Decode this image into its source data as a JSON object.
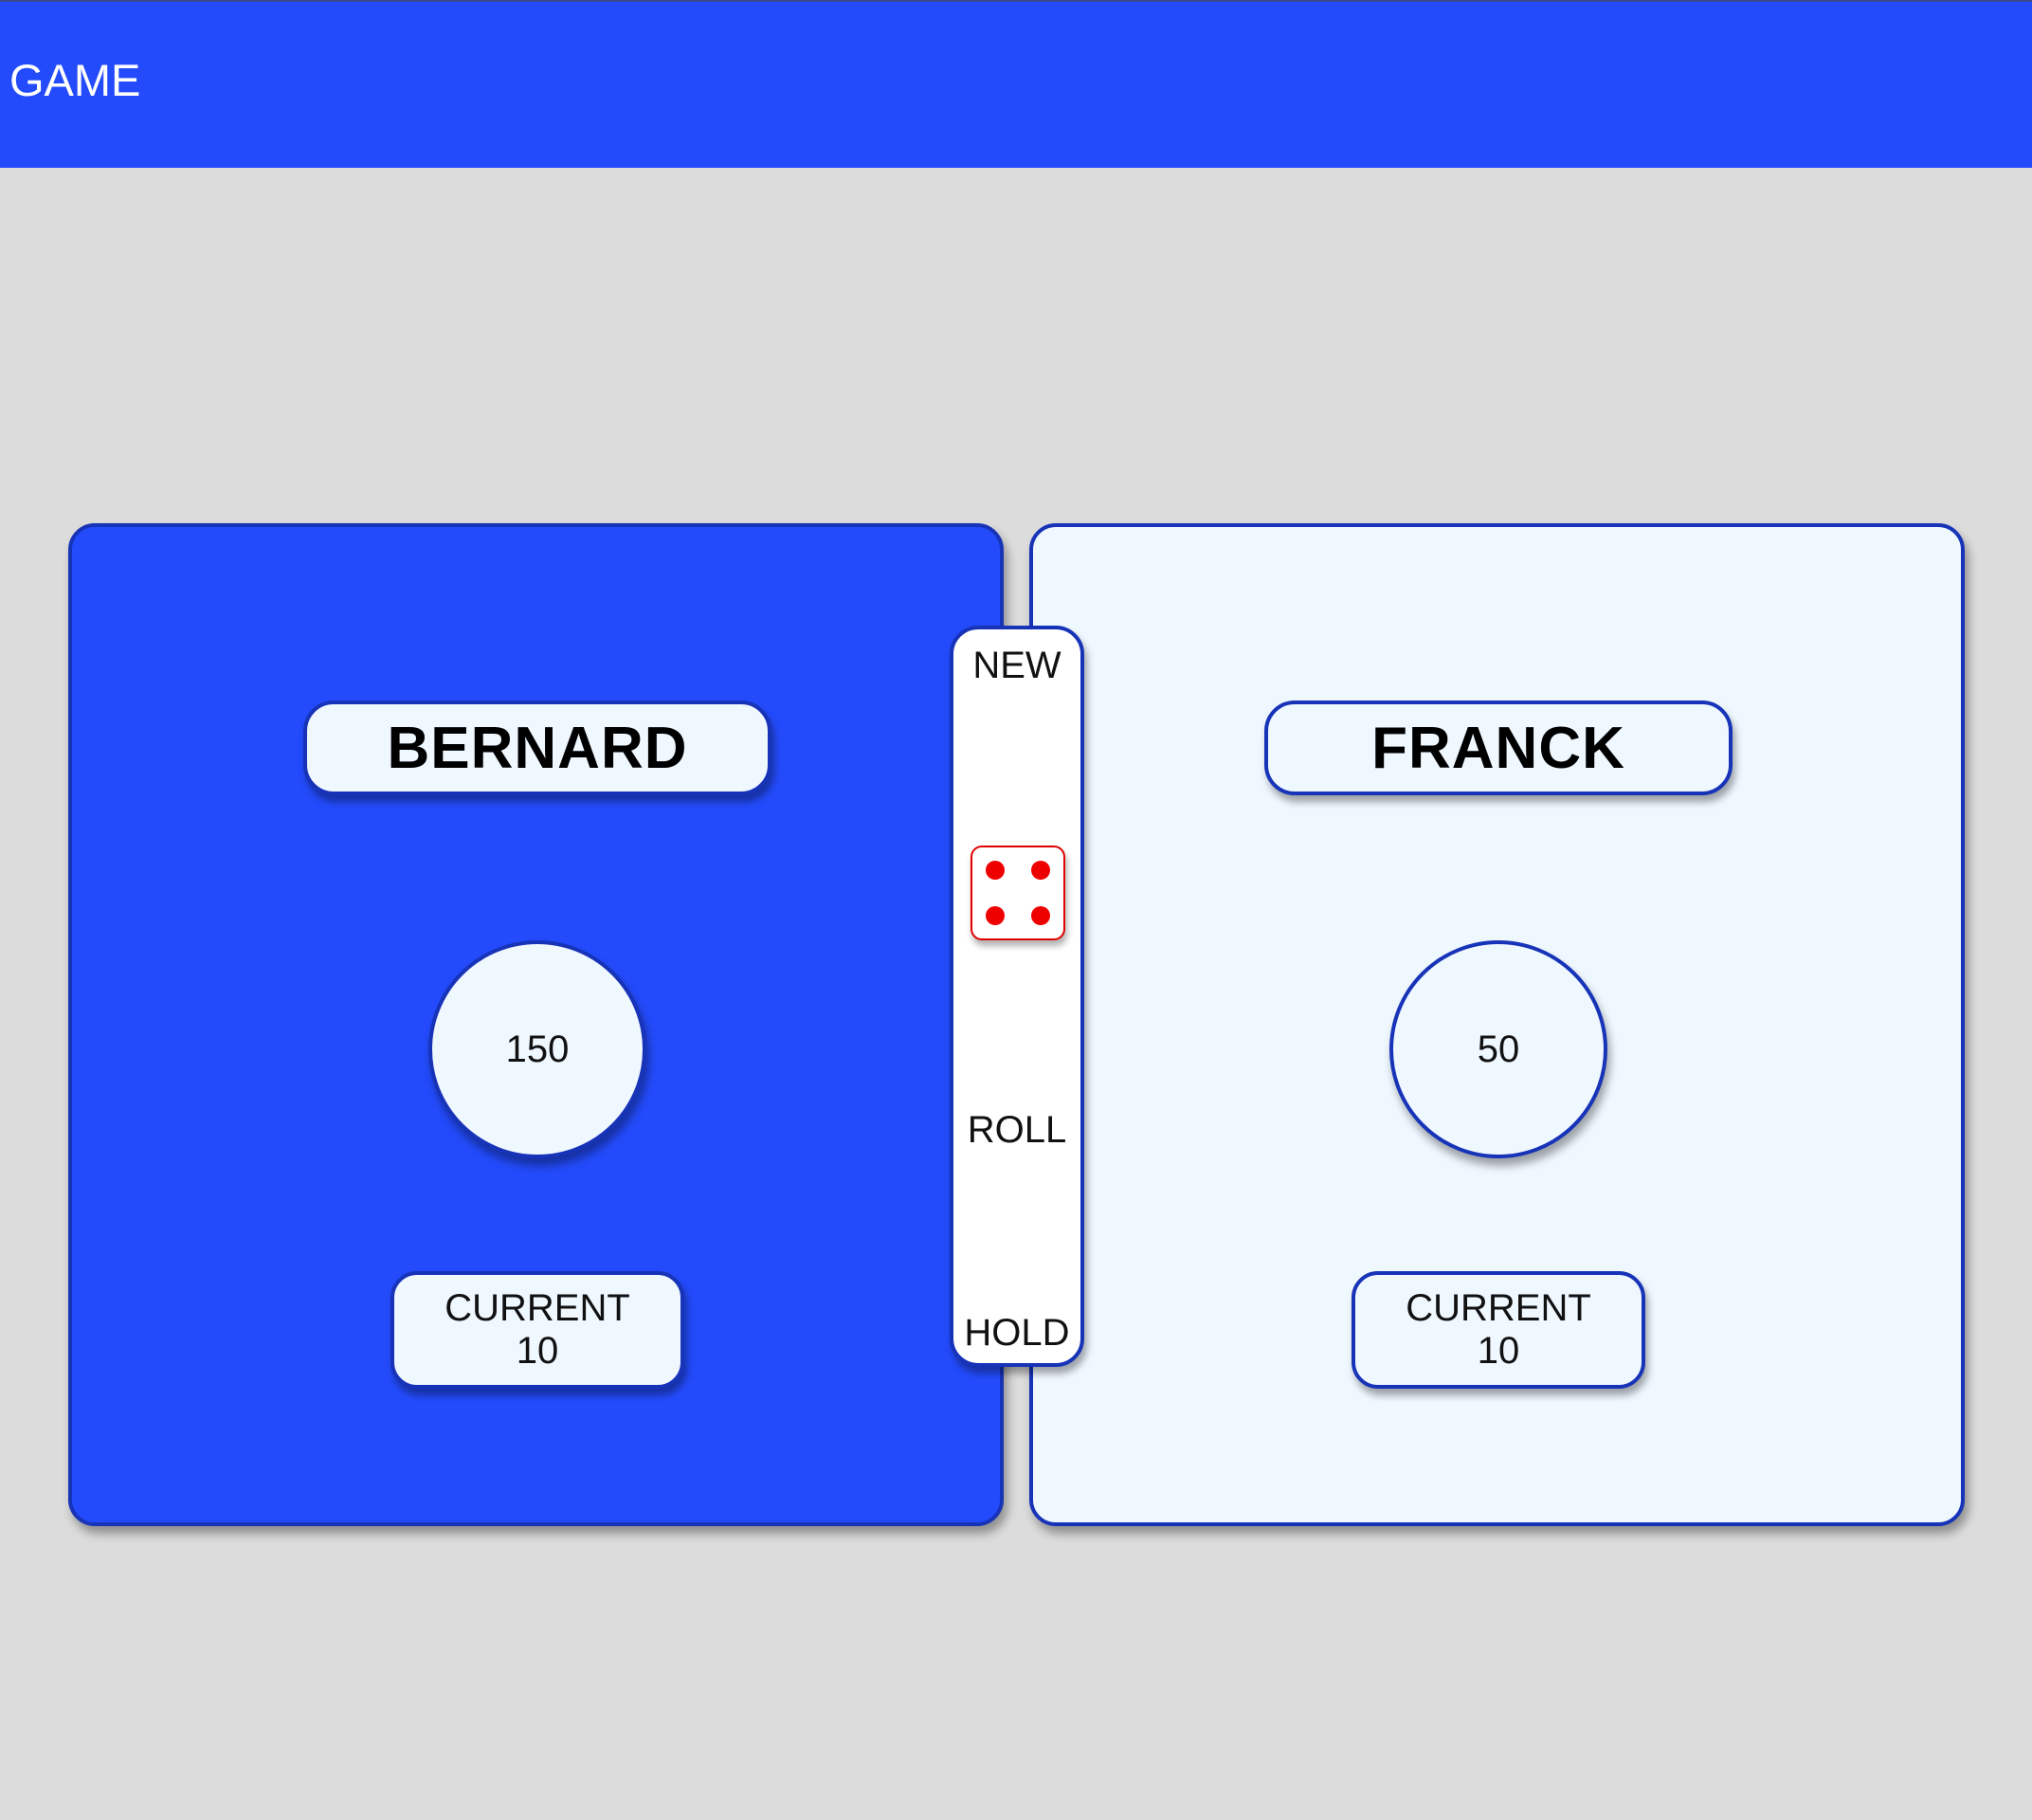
{
  "header": {
    "title": "GAME",
    "color": "#234bfb"
  },
  "players": [
    {
      "name": "BERNARD",
      "score": "150",
      "current_label": "CURRENT",
      "current_value": "10",
      "active": true,
      "panel_color": "#234bfb"
    },
    {
      "name": "FRANCK",
      "score": "50",
      "current_label": "CURRENT",
      "current_value": "10",
      "active": false,
      "panel_color": "#eff7ff"
    }
  ],
  "controls": {
    "new_label": "NEW",
    "roll_label": "ROLL",
    "hold_label": "HOLD"
  },
  "dice": {
    "value": 4,
    "pip_color": "#ee0000",
    "icon": "dice-four-icon"
  }
}
